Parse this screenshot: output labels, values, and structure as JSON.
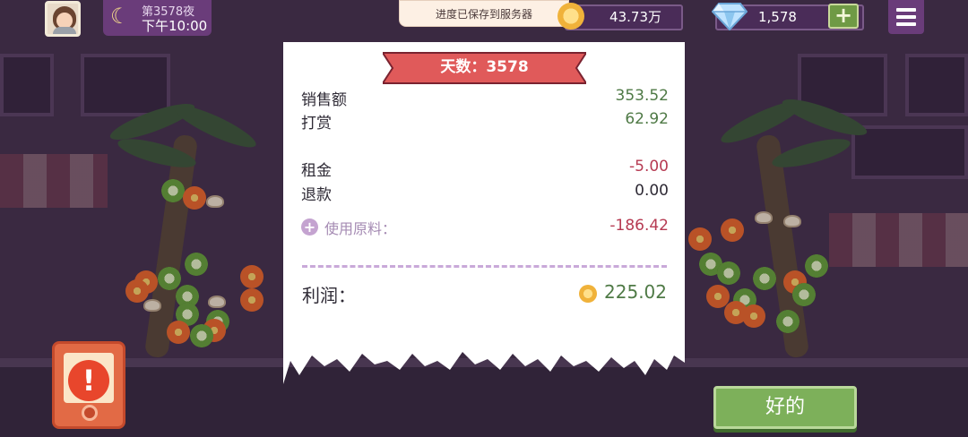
{
  "hud": {
    "night_label": "第3578夜",
    "time": "下午10:00",
    "coins": "43.73万",
    "gems": "1,578",
    "plus_label": "+"
  },
  "toast": "进度已保存到服务器",
  "receipt": {
    "day_banner": "天数：3578",
    "sales_label": "销售额",
    "sales_value": "353.52",
    "tips_label": "打赏",
    "tips_value": "62.92",
    "rent_label": "租金",
    "rent_value": "-5.00",
    "refund_label": "退款",
    "refund_value": "0.00",
    "ingredients_label": "使用原料：",
    "ingredients_value": "-186.42",
    "profit_label": "利润：",
    "profit_value": "225.02"
  },
  "buttons": {
    "ok": "好的"
  },
  "colors": {
    "positive": "#4f7a46",
    "negative": "#b63a52",
    "banner": "#e05a5a",
    "ok_button": "#7db05a",
    "hud_panel": "#6a3c7a"
  }
}
